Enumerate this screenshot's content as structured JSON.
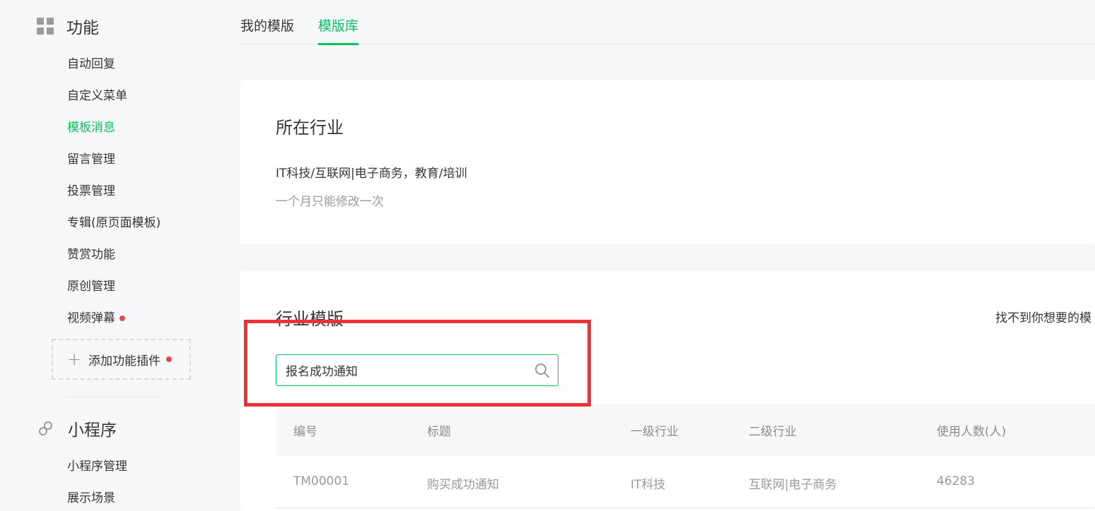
{
  "sidebar": {
    "features_title": "功能",
    "feature_items": [
      {
        "label": "自动回复"
      },
      {
        "label": "自定义菜单"
      },
      {
        "label": "模板消息"
      },
      {
        "label": "留言管理"
      },
      {
        "label": "投票管理"
      },
      {
        "label": "专辑(原页面模板)"
      },
      {
        "label": "赞赏功能"
      },
      {
        "label": "原创管理"
      },
      {
        "label": "视频弹幕"
      }
    ],
    "add_plugin_label": "添加功能插件",
    "miniprogram_title": "小程序",
    "miniprogram_items": [
      {
        "label": "小程序管理"
      },
      {
        "label": "展示场景"
      }
    ]
  },
  "tabs": [
    {
      "label": "我的模版"
    },
    {
      "label": "模版库"
    }
  ],
  "industry_card": {
    "title": "所在行业",
    "value": "IT科技/互联网|电子商务，教育/培训",
    "note": "一个月只能修改一次"
  },
  "template_card": {
    "title": "行业模版",
    "help_link": "找不到你想要的模",
    "search": {
      "value": "报名成功通知"
    },
    "columns": [
      "编号",
      "标题",
      "一级行业",
      "二级行业",
      "使用人数(人)"
    ],
    "rows": [
      {
        "id": "TM00001",
        "title": "购买成功通知",
        "primary": "IT科技",
        "secondary": "互联网|电子商务",
        "users": "46283"
      }
    ]
  },
  "colors": {
    "accent": "#07c160",
    "highlight": "#ee3338",
    "dot": "#e5484d"
  }
}
